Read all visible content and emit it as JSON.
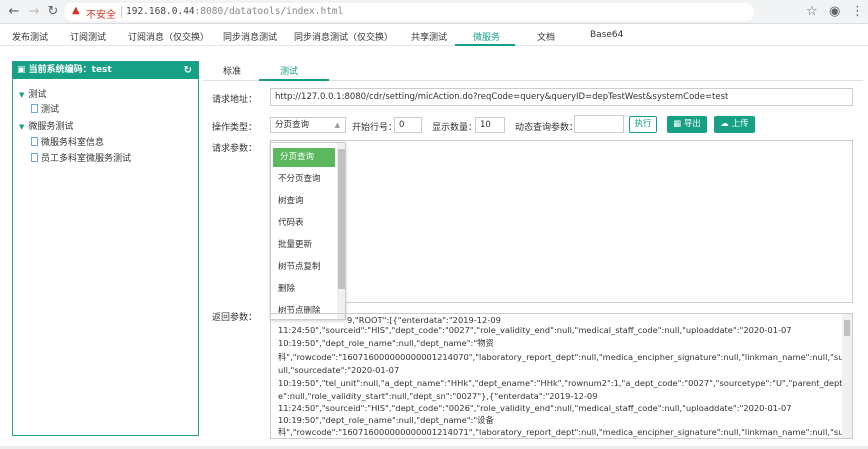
{
  "browser": {
    "insecure_label": "不安全",
    "url_host": "192.168.0.44",
    "url_rest": ":8080/datatools/index.html",
    "back_icon": "arrow-left-icon",
    "forward_icon": "arrow-right-icon",
    "reload_icon": "reload-icon"
  },
  "nav": {
    "items": [
      "发布测试",
      "订阅测试",
      "订阅消息（仅交换）",
      "同步消息测试",
      "同步消息测试（仅交换）",
      "共享测试",
      "微服务",
      "文档",
      "Base64"
    ],
    "active_index": 6
  },
  "sidebar": {
    "title": "当前系统编码：test",
    "tree": [
      {
        "label": "测试",
        "type": "folder"
      },
      {
        "label": "测试",
        "type": "file"
      },
      {
        "label": "微服务测试",
        "type": "folder"
      },
      {
        "label": "微服务科室信息",
        "type": "file"
      },
      {
        "label": "员工多科室微服务测试",
        "type": "file"
      }
    ]
  },
  "tabs": [
    "标准",
    "测试"
  ],
  "form": {
    "url_label": "请求地址：",
    "url_value": "http://127.0.0.1:8080/cdr/setting/micAction.do?reqCode=query&queryID=depTestWest&systemCode=test",
    "op_label": "操作类型：",
    "op_value": "分页查询",
    "start_label": "开始行号：",
    "start_value": "0",
    "count_label": "显示数量：",
    "count_value": "10",
    "dyn_label": "动态查询参数：",
    "dyn_value": "",
    "exec_button": "执行",
    "export_button": "导出",
    "upload_button": "上传",
    "params_label": "请求参数：",
    "result_label": "返回参数："
  },
  "dropdown_options": [
    "分页查询",
    "不分页查询",
    "树查询",
    "代码表",
    "批量更新",
    "树节点复制",
    "删除",
    "树节点删除"
  ],
  "result_lines": [
    "9,\"ROOT\":[{\"enterdata\":\"2019-12-09",
    "11:24:50\",\"sourceid\":\"HIS\",\"dept_code\":\"0027\",\"role_validity_end\":null,\"medical_staff_code\":null,\"uploaddate\":\"2020-01-07",
    "10:19:50\",\"dept_role_name\":null,\"dept_name\":\"物资",
    "科\",\"rowcode\":\"160716000000000001214070\",\"laboratory_report_dept\":null,\"medica_encipher_signature\":null,\"linkman_name\":null,\"superior_dept_name\":n",
    "ull,\"sourcedate\":\"2020-01-07",
    "10:19:50\",\"tel_unit\":null,\"a_dept_name\":\"HHk\",\"dept_ename\":\"HHk\",\"rownum2\":1,\"a_dept_code\":\"0027\",\"sourcetype\":\"U\",\"parent_dept_code\":null,\"dept_typ",
    "e\":null,\"role_validity_start\":null,\"dept_sn\":\"0027\"},{\"enterdata\":\"2019-12-09",
    "11:24:50\",\"sourceid\":\"HIS\",\"dept_code\":\"0026\",\"role_validity_end\":null,\"medical_staff_code\":null,\"uploaddate\":\"2020-01-07",
    "10:19:50\",\"dept_role_name\":null,\"dept_name\":\"设备",
    "科\",\"rowcode\":\"160716000000000001214071\",\"laboratory_report_dept\":null,\"medica_encipher_signature\":null,\"linkman_name\":null,\"superior_dept_name\":n"
  ]
}
